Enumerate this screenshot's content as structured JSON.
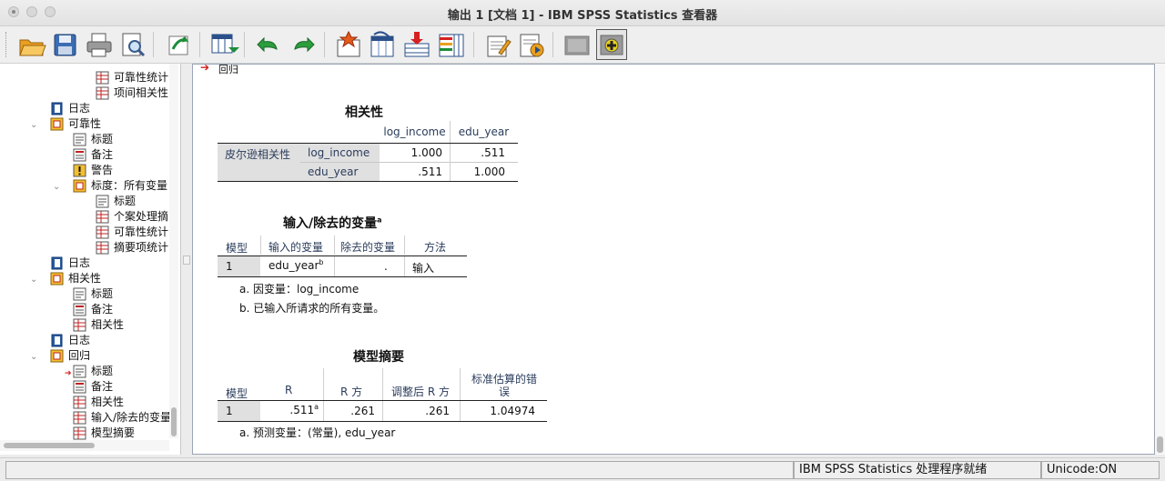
{
  "window": {
    "title": "输出 1 [文档 1] - IBM SPSS Statistics 查看器"
  },
  "toolbar": {
    "buttons": [
      "open-icon",
      "save-icon",
      "print-icon",
      "print-preview-icon",
      "recall-dialog-icon",
      "goto-data-icon",
      "undo-icon",
      "redo-icon",
      "goto-case-icon",
      "goto-variable-icon",
      "insert-cases-icon",
      "variables-icon",
      "designate-window-icon",
      "run-script-icon",
      "hide-outline-icon",
      "show-outline-icon"
    ]
  },
  "nav": {
    "items": [
      {
        "label": "可靠性统计"
      },
      {
        "label": "项间相关性"
      },
      {
        "label": "日志"
      },
      {
        "label": "可靠性"
      },
      {
        "label": "标题"
      },
      {
        "label": "备注"
      },
      {
        "label": "警告"
      },
      {
        "label": "标度：所有变量"
      },
      {
        "label": "标题"
      },
      {
        "label": "个案处理摘"
      },
      {
        "label": "可靠性统计"
      },
      {
        "label": "摘要项统计"
      },
      {
        "label": "日志"
      },
      {
        "label": "相关性"
      },
      {
        "label": "标题"
      },
      {
        "label": "备注"
      },
      {
        "label": "相关性"
      },
      {
        "label": "日志"
      },
      {
        "label": "回归"
      },
      {
        "label": "标题"
      },
      {
        "label": "备注"
      },
      {
        "label": "相关性"
      },
      {
        "label": "输入/除去的变量"
      },
      {
        "label": "模型摘要"
      }
    ]
  },
  "content": {
    "section_label": "回归",
    "correlations": {
      "title": "相关性",
      "col_headers": [
        "log_income",
        "edu_year"
      ],
      "row_group": "皮尔逊相关性",
      "rows": [
        {
          "name": "log_income",
          "values": [
            "1.000",
            ".511"
          ]
        },
        {
          "name": "edu_year",
          "values": [
            ".511",
            "1.000"
          ]
        }
      ]
    },
    "variables": {
      "title": "输入/除去的变量",
      "title_sup": "a",
      "headers": [
        "模型",
        "输入的变量",
        "除去的变量",
        "方法"
      ],
      "row": {
        "model": "1",
        "entered": "edu_year",
        "entered_sup": "b",
        "removed": ".",
        "method": "输入"
      },
      "footnotes": [
        "a. 因变量：log_income",
        "b. 已输入所请求的所有变量。"
      ]
    },
    "model_summary": {
      "title": "模型摘要",
      "headers": [
        "模型",
        "R",
        "R 方",
        "调整后 R 方",
        "标准估算的错",
        "误"
      ],
      "row": {
        "model": "1",
        "r": ".511",
        "r_sup": "a",
        "r_sq": ".261",
        "adj_r_sq": ".261",
        "se": "1.04974"
      },
      "footnote": "a. 预测变量：(常量), edu_year"
    }
  },
  "statusbar": {
    "processor": "IBM SPSS Statistics 处理程序就绪",
    "unicode": "Unicode:ON"
  }
}
